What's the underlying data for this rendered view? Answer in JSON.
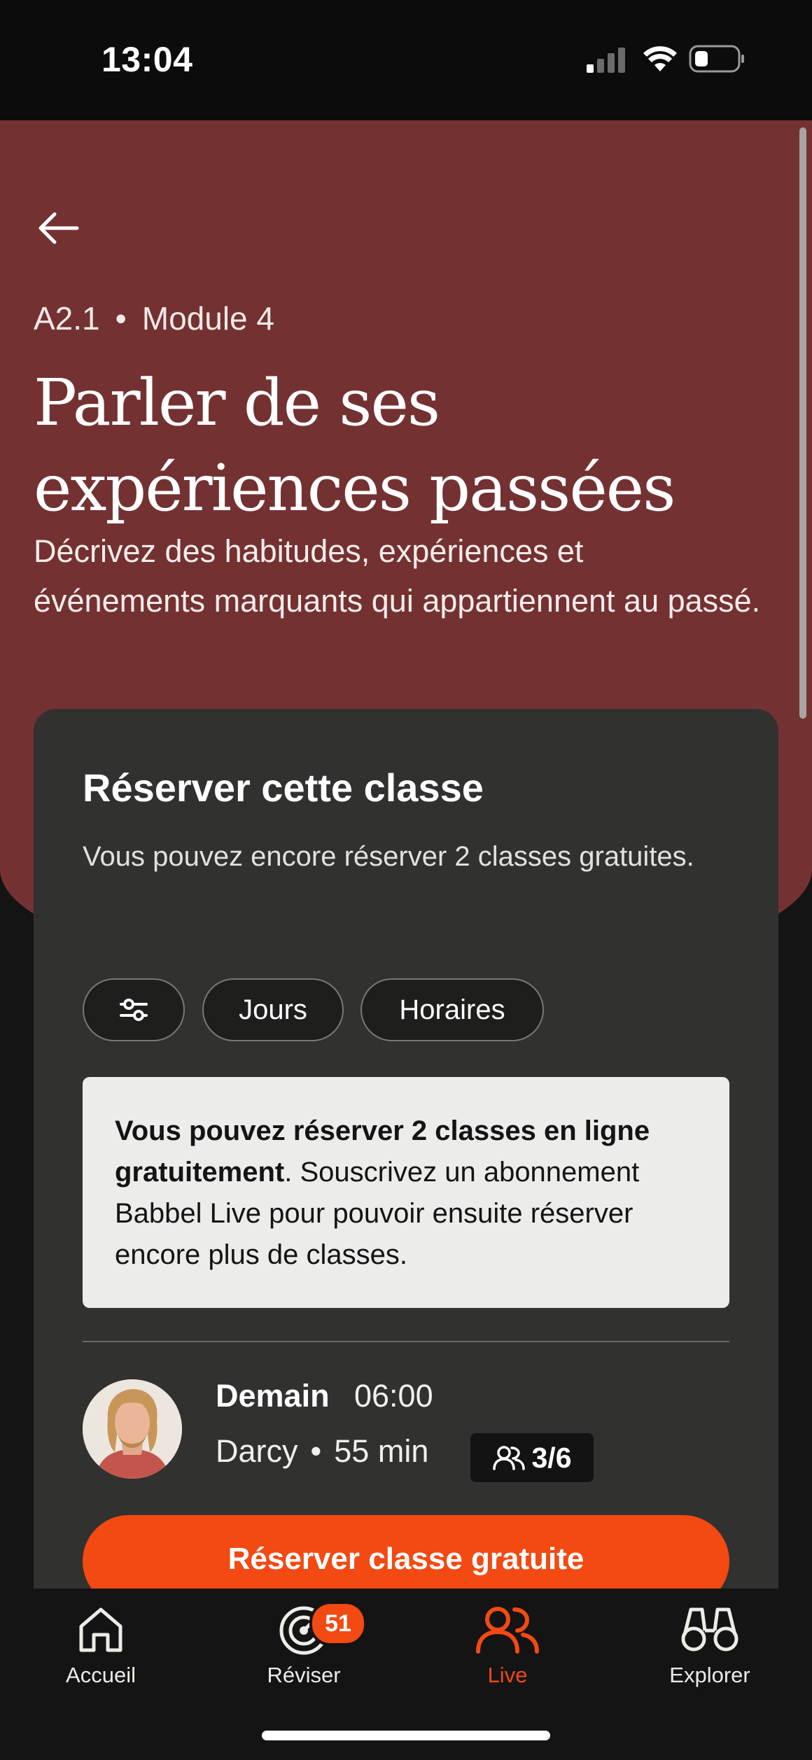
{
  "status_bar": {
    "time": "13:04"
  },
  "header": {
    "level": "A2.1",
    "separator": "•",
    "module": "Module 4",
    "title_line1": "Parler de ses",
    "title_line2": "expériences passées",
    "subtitle": "Décrivez des habitudes, expériences et événements marquants qui appartiennent au passé."
  },
  "booking": {
    "title": "Réserver cette classe",
    "description": "Vous pouvez encore réserver 2 classes gratuites.",
    "filters": {
      "filter_icon": "sliders-icon",
      "days_label": "Jours",
      "hours_label": "Horaires"
    },
    "info": {
      "bold_text": "Vous pouvez réserver 2 classes en ligne gratuitement",
      "rest_text": ". Souscrivez un abonnement Babbel Live pour pouvoir ensuite réserver encore plus de classes."
    },
    "session": {
      "day": "Demain",
      "time": "06:00",
      "teacher": "Darcy",
      "separator": "•",
      "duration": "55 min",
      "capacity": "3/6"
    },
    "cta_label": "Réserver classe gratuite"
  },
  "bottom_nav": {
    "items": [
      {
        "label": "Accueil",
        "icon": "home-icon"
      },
      {
        "label": "Réviser",
        "icon": "target-icon",
        "badge": "51"
      },
      {
        "label": "Live",
        "icon": "people-icon",
        "active": true
      },
      {
        "label": "Explorer",
        "icon": "binoculars-icon"
      }
    ]
  },
  "colors": {
    "hero_background": "#743132",
    "card_background": "#31312f",
    "accent": "#f24a12",
    "page_background": "#141414"
  }
}
